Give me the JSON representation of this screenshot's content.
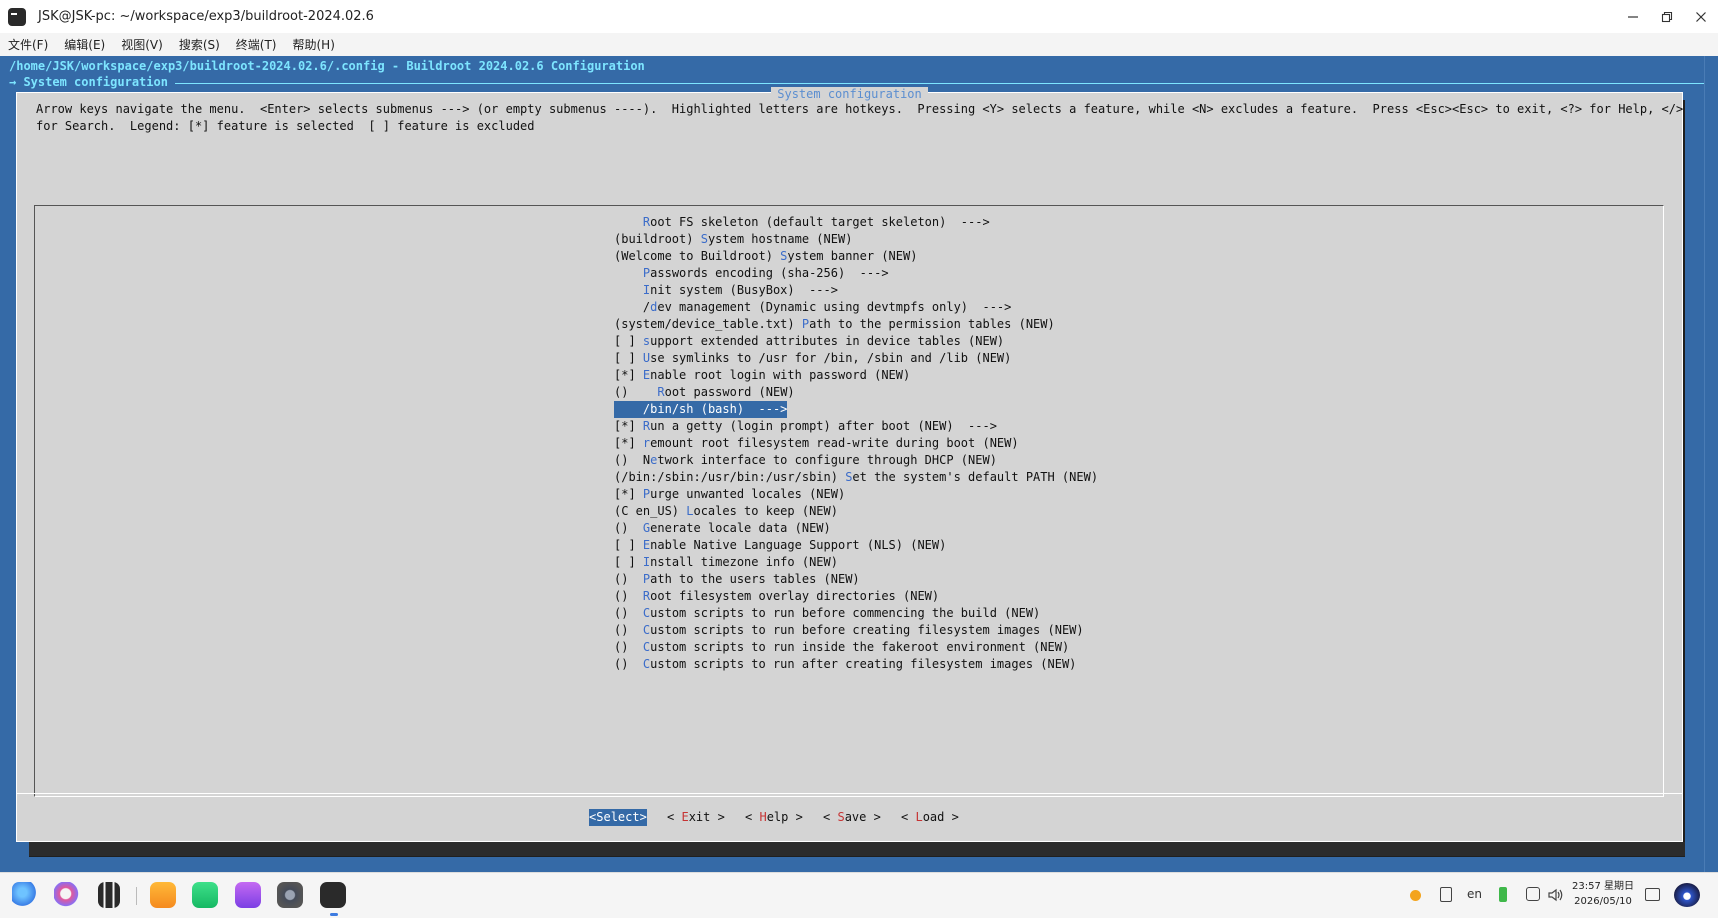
{
  "window": {
    "title": "JSK@JSK-pc: ~/workspace/exp3/buildroot-2024.02.6",
    "controls": [
      "minimize-icon",
      "restore-icon",
      "close-icon"
    ]
  },
  "menubar": {
    "items": [
      "文件(F)",
      "编辑(E)",
      "视图(V)",
      "搜索(S)",
      "终端(T)",
      "帮助(H)"
    ]
  },
  "terminal": {
    "config_path": "/home/JSK/workspace/exp3/buildroot-2024.02.6/.config - Buildroot 2024.02.6 Configuration",
    "section_crumb": "→ System configuration",
    "dialog_title": "System configuration",
    "help_line_1": "Arrow keys navigate the menu.  <Enter> selects submenus ---> (or empty submenus ----).  Highlighted letters are hotkeys.  Pressing <Y> selects a feature, while <N> excludes a feature.  Press <Esc><Esc> to exit, <?> for Help, </>",
    "help_line_2": "for Search.  Legend: [*] feature is selected  [ ] feature is excluded",
    "entries": [
      {
        "pre": "    ",
        "hk": "R",
        "post": "oot FS skeleton (default target skeleton)  --->"
      },
      {
        "pre": "(buildroot) ",
        "hk": "S",
        "post": "ystem hostname (NEW)"
      },
      {
        "pre": "(Welcome to Buildroot) ",
        "hk": "S",
        "post": "ystem banner (NEW)"
      },
      {
        "pre": "    ",
        "hk": "P",
        "post": "asswords encoding (sha-256)  --->"
      },
      {
        "pre": "    ",
        "hk": "I",
        "post": "nit system (BusyBox)  --->"
      },
      {
        "pre": "    /",
        "hk": "d",
        "post": "ev management (Dynamic using devtmpfs only)  --->"
      },
      {
        "pre": "(system/device_table.txt) ",
        "hk": "P",
        "post": "ath to the permission tables (NEW)"
      },
      {
        "pre": "[ ] ",
        "hk": "s",
        "post": "upport extended attributes in device tables (NEW)"
      },
      {
        "pre": "[ ] ",
        "hk": "U",
        "post": "se symlinks to /usr for /bin, /sbin and /lib (NEW)"
      },
      {
        "pre": "[*] ",
        "hk": "E",
        "post": "nable root login with password (NEW)"
      },
      {
        "pre": "()    ",
        "hk": "R",
        "post": "oot password (NEW)"
      },
      {
        "pre": "    ",
        "hk": "/",
        "post": "bin/sh (bash)  --->"
      },
      {
        "pre": "[*] ",
        "hk": "R",
        "post": "un a getty (login prompt) after boot (NEW)  --->"
      },
      {
        "pre": "[*] ",
        "hk": "r",
        "post": "emount root filesystem read-write during boot (NEW)"
      },
      {
        "pre": "()  N",
        "hk": "e",
        "post": "twork interface to configure through DHCP (NEW)"
      },
      {
        "pre": "(/bin:/sbin:/usr/bin:/usr/sbin) ",
        "hk": "S",
        "post": "et the system's default PATH (NEW)"
      },
      {
        "pre": "[*] ",
        "hk": "P",
        "post": "urge unwanted locales (NEW)"
      },
      {
        "pre": "(C en_US) ",
        "hk": "L",
        "post": "ocales to keep (NEW)"
      },
      {
        "pre": "()  ",
        "hk": "G",
        "post": "enerate locale data (NEW)"
      },
      {
        "pre": "[ ] ",
        "hk": "E",
        "post": "nable Native Language Support (NLS) (NEW)"
      },
      {
        "pre": "[ ] ",
        "hk": "I",
        "post": "nstall timezone info (NEW)"
      },
      {
        "pre": "()  ",
        "hk": "P",
        "post": "ath to the users tables (NEW)"
      },
      {
        "pre": "()  ",
        "hk": "R",
        "post": "oot filesystem overlay directories (NEW)"
      },
      {
        "pre": "()  ",
        "hk": "C",
        "post": "ustom scripts to run before commencing the build (NEW)"
      },
      {
        "pre": "()  ",
        "hk": "C",
        "post": "ustom scripts to run before creating filesystem images (NEW)"
      },
      {
        "pre": "()  ",
        "hk": "C",
        "post": "ustom scripts to run inside the fakeroot environment (NEW)"
      },
      {
        "pre": "()  ",
        "hk": "C",
        "post": "ustom scripts to run after creating filesystem images (NEW)"
      }
    ],
    "selected_index": 11,
    "buttons": [
      {
        "pre": "<",
        "hk": "S",
        "post": "elect>",
        "active": true
      },
      {
        "pre": "< ",
        "hk": "E",
        "post": "xit >",
        "active": false
      },
      {
        "pre": "< ",
        "hk": "H",
        "post": "elp >",
        "active": false
      },
      {
        "pre": "< ",
        "hk": "S",
        "post": "ave >",
        "active": false
      },
      {
        "pre": "< ",
        "hk": "L",
        "post": "oad >",
        "active": false
      }
    ]
  },
  "taskbar": {
    "apps": [
      "launcher-icon",
      "search-app-icon",
      "multitask-icon",
      "downloader-icon",
      "chat-app-icon",
      "camera-app-icon",
      "settings-app-icon",
      "terminal-app-icon"
    ],
    "lang": "en",
    "time": "23:57 星期日",
    "date": "2026/05/10"
  },
  "colors": {
    "terminal_bg": "#356aa7",
    "dialog_bg": "#d4d4d4",
    "hotkey": "#3b6cc9",
    "button_hotkey": "#c63333",
    "header_text": "#7de5ff"
  }
}
